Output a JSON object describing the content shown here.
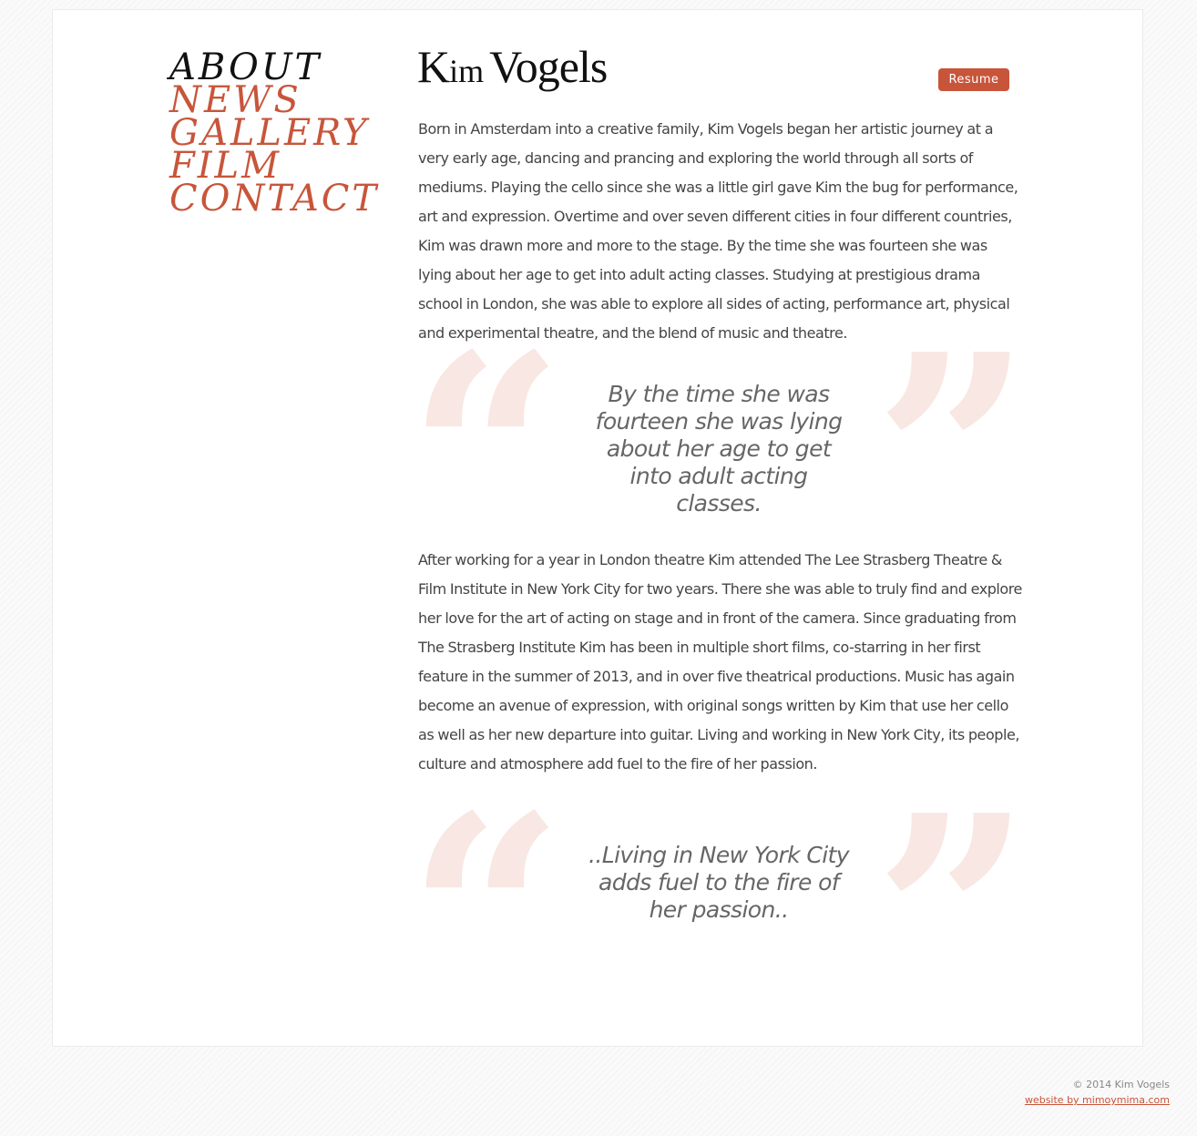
{
  "nav": {
    "items": [
      {
        "label": "ABOUT",
        "active": true
      },
      {
        "label": "NEWS",
        "active": false
      },
      {
        "label": "GALLERY",
        "active": false
      },
      {
        "label": "FILM",
        "active": false
      },
      {
        "label": "CONTACT",
        "active": false
      }
    ]
  },
  "header": {
    "logo_parts": [
      "K",
      "im",
      "Vogels"
    ],
    "logo_text": "KimVogels",
    "resume_label": "Resume"
  },
  "content": {
    "paragraph1": "Born in Amsterdam into a creative family, Kim Vogels began her artistic journey at a very early age, dancing and prancing and exploring the world through all sorts of mediums. Playing the cello since she was a little girl gave Kim the bug for performance, art and expression. Overtime and over seven different cities in four different countries, Kim was drawn more and more to the stage. By the time she was fourteen she was lying about her age to get into adult acting classes. Studying at prestigious drama school in London, she was able to explore all sides of acting, performance art, physical and experimental theatre, and the blend of music and theatre.",
    "quote1": "By the time she was fourteen she was lying about her age to get into adult acting classes.",
    "paragraph2": "After working for a year in London theatre Kim attended The Lee Strasberg Theatre & Film Institute in New York City for two years. There she was able to truly find and explore her love for the art of acting on stage and in front of the camera. Since graduating from The Strasberg Institute Kim has been in multiple short films, co-starring in her first feature in the summer of 2013, and in over five theatrical productions. Music has again become an avenue of expression, with original songs written by Kim that use her cello as well as her new departure into guitar. Living and working in New York City, its people, culture and atmosphere add fuel to the fire of her passion.",
    "quote2": "..Living in New York City adds fuel to the fire of her passion.."
  },
  "quote_marks": {
    "open": "“",
    "close": "”"
  },
  "footer": {
    "copyright": "© 2014 Kim Vogels",
    "credit": "website by mimoymima.com"
  },
  "colors": {
    "accent": "#c8553a",
    "text": "#444444",
    "quote_mark": "#f8e7e2"
  }
}
